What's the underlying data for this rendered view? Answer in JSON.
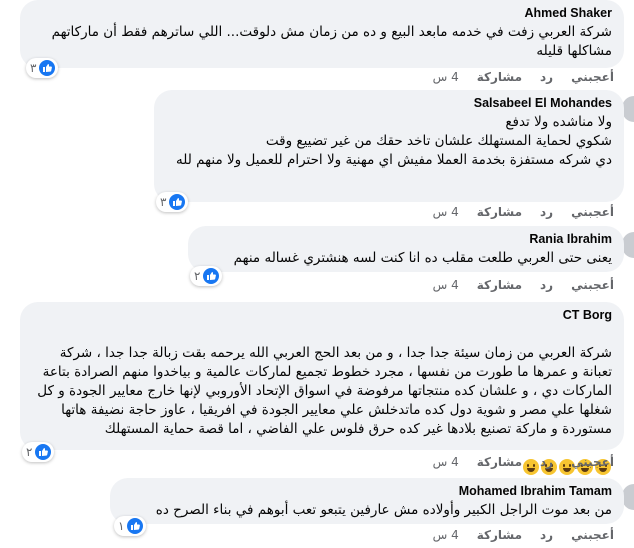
{
  "comments": [
    {
      "author": "Ahmed Shaker",
      "text": "شركة العربي زفت في خدمه مابعد البيع و ده من زمان مش دلوقت... اللي ساترهم فقط أن ماركاتهم مشاكلها قليله",
      "reactions": "٣",
      "like": "أعجبني",
      "reply": "رد",
      "share": "مشاركة",
      "time": "4 س"
    },
    {
      "author": "Salsabeel El Mohandes",
      "text": "ولا مناشده ولا تدفع\nشكوي لحماية المستهلك علشان تاخد حقك من غير تضييع وقت\nدي شركه مستفزة بخدمة العملا مفيش اي مهنية ولا احترام للعميل ولا منهم لله",
      "reactions": "٣",
      "like": "أعجبني",
      "reply": "رد",
      "share": "مشاركة",
      "time": "4 س"
    },
    {
      "author": "Rania Ibrahim",
      "text": "يعنى حتى العربي طلعت مقلب ده انا كنت لسه هنشتري غساله منهم",
      "reactions": "٢",
      "like": "أعجبني",
      "reply": "رد",
      "share": "مشاركة",
      "time": "4 س"
    },
    {
      "author": "CT Borg",
      "text": "شركة العربي من زمان سيئة جدا جدا ، و من بعد الحج العربي الله يرحمه بقت زبالة جدا جدا ، شركة تعبانة و عمرها ما طورت من نفسها ، مجرد خطوط تجميع لماركات عالمية و بياخدوا منهم الصرادة بتاعة الماركات دي ، و علشان كده منتجاتها مرفوضة في اسواق الإتحاد الأوروبي لإنها خارج معايير الجودة و كل شغلها علي مصر و شوية دول كده ماتدخلش علي معايير الجودة في افريقيا ، عاوز حاجة نضيفة هاتها مستوردة و ماركة تصنيع بلادها غير كده حرق فلوس علي الفاضي ، اما قصة حماية المستهلك",
      "reactions": "٢",
      "like": "أعجبني",
      "reply": "رد",
      "share": "مشاركة",
      "time": "4 س"
    },
    {
      "author": "Mohamed Ibrahim Tamam",
      "text": "من بعد موت الراجل الكبير وأولاده مش عارفين يتبعو تعب أبوهم في بناء الصرح ده",
      "reactions": "١",
      "like": "أعجبني",
      "reply": "رد",
      "share": "مشاركة",
      "time": "4 س"
    }
  ],
  "colors": {
    "bubble": "#f0f2f5",
    "like_blue": "#1877f2",
    "meta": "#65676b"
  },
  "icons": {
    "reaction": "like-icon",
    "emoji": "grinning-face-icon"
  }
}
